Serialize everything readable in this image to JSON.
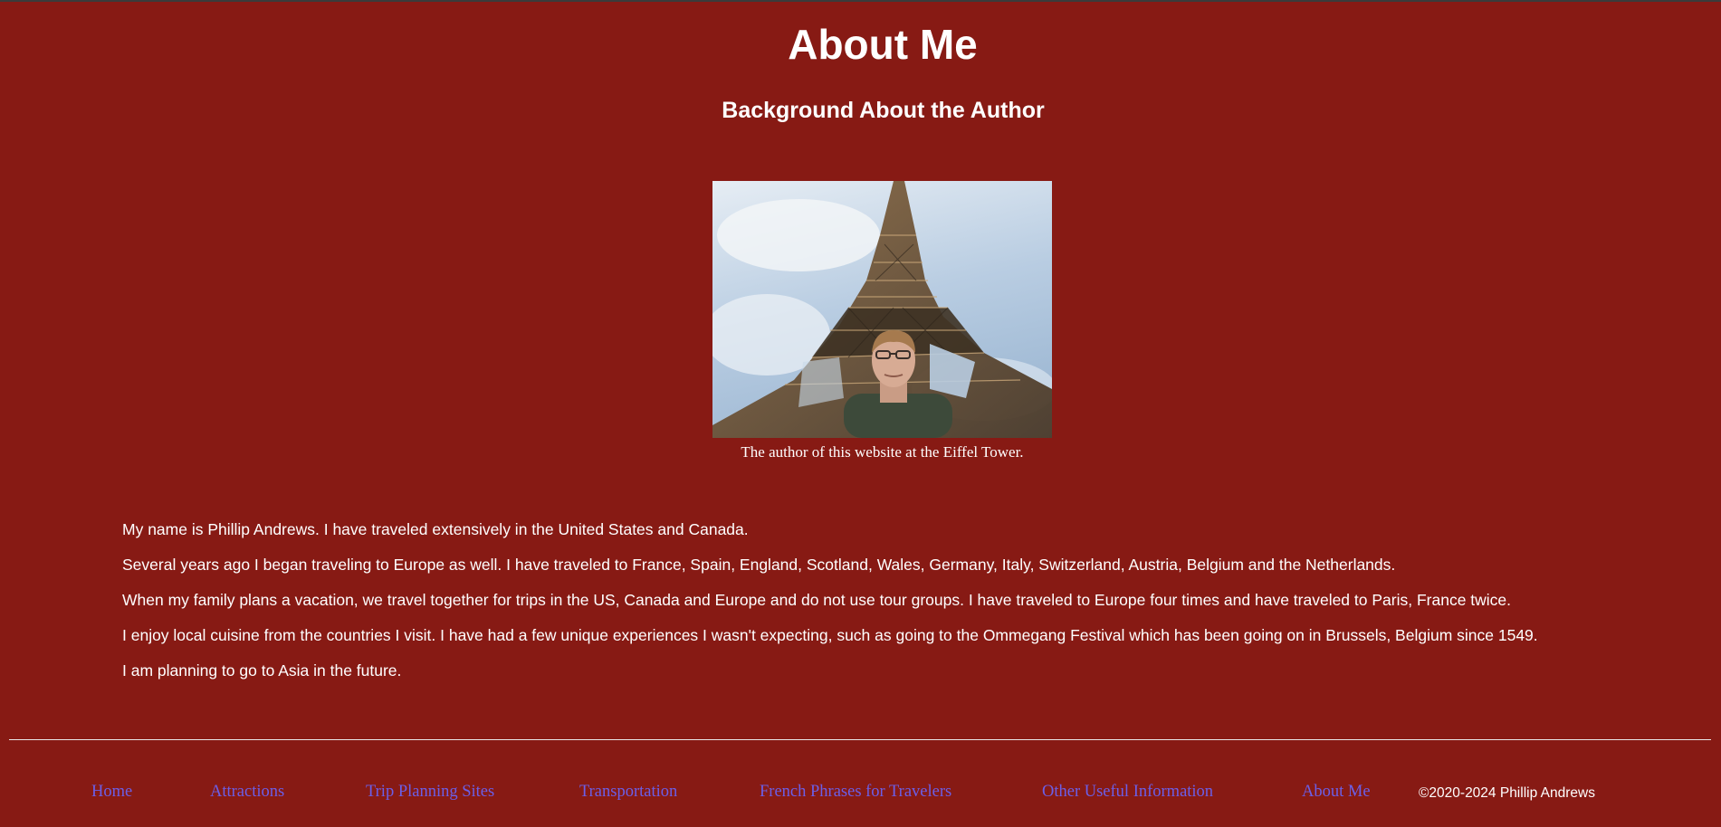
{
  "header": {
    "title": "About Me",
    "subtitle": "Background About the Author"
  },
  "figure": {
    "caption": "The author of this website at the Eiffel Tower."
  },
  "bio": {
    "paragraphs": [
      "My name is Phillip Andrews. I have traveled extensively in the United States and Canada.",
      "Several years ago I began traveling to Europe as well. I have traveled to France, Spain, England, Scotland, Wales, Germany, Italy, Switzerland, Austria, Belgium and the Netherlands.",
      "When my family plans a vacation, we travel together for trips in the US, Canada and Europe and do not use tour groups. I have traveled to Europe four times and have traveled to Paris, France twice.",
      "I enjoy local cuisine from the countries I visit. I have had a few unique experiences I wasn't expecting, such as going to the Ommegang Festival which has been going on in Brussels, Belgium since 1549.",
      "I am planning to go to Asia in the future."
    ]
  },
  "footer": {
    "nav": [
      {
        "label": "Home"
      },
      {
        "label": "Attractions"
      },
      {
        "label": "Trip Planning Sites"
      },
      {
        "label": "Transportation"
      },
      {
        "label": "French Phrases for Travelers"
      },
      {
        "label": "Other Useful Information"
      },
      {
        "label": "About Me"
      }
    ],
    "copyright": "©2020-2024 Phillip Andrews"
  },
  "colors": {
    "background": "#871a14",
    "text": "#ffffff",
    "link": "#6b5fe8"
  }
}
